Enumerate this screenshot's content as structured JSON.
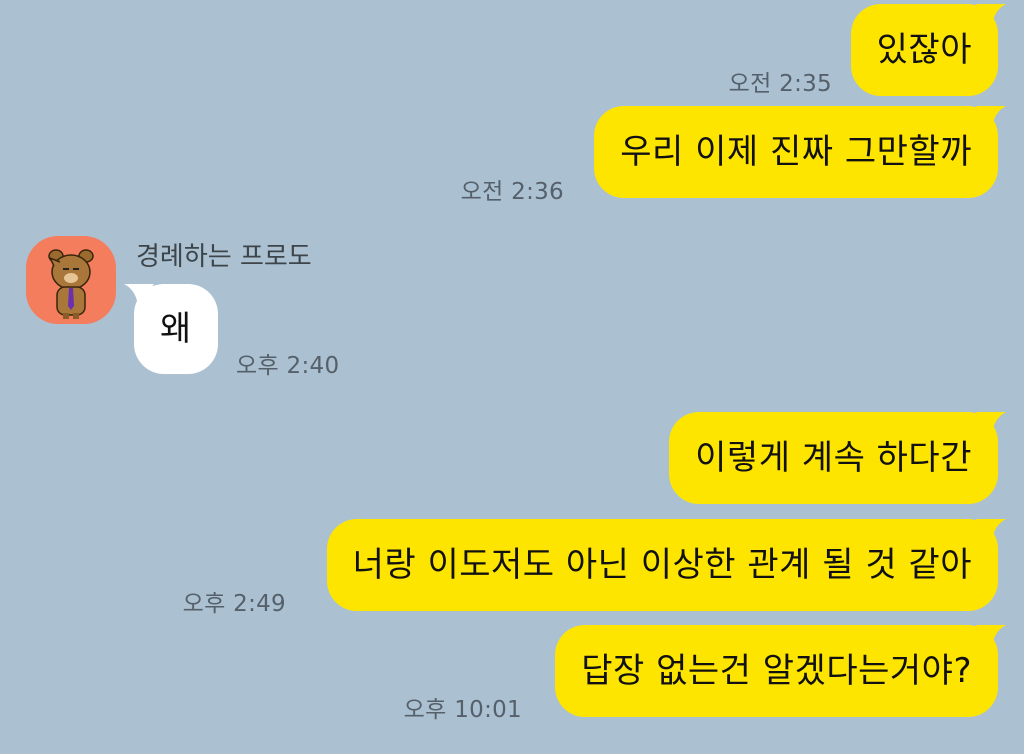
{
  "chat": {
    "sender_name": "경례하는 프로도",
    "messages": [
      {
        "text": "있잖아",
        "time": "오전 2:35"
      },
      {
        "text": "우리 이제 진짜 그만할까",
        "time": "오전 2:36"
      },
      {
        "text": "왜",
        "time": "오후 2:40"
      },
      {
        "text": "이렇게 계속 하다간",
        "time": ""
      },
      {
        "text": "너랑 이도저도 아닌 이상한 관계 될 것 같아",
        "time": "오후 2:49"
      },
      {
        "text": "답장 없는건 알겠다는거야?",
        "time": "오후 10:01"
      }
    ]
  },
  "colors": {
    "background": "#abc1d1",
    "my_bubble": "#fee500",
    "other_bubble": "#ffffff",
    "avatar_bg": "#f47d5e"
  },
  "icons": {
    "avatar": "saluting-frodo-character"
  }
}
